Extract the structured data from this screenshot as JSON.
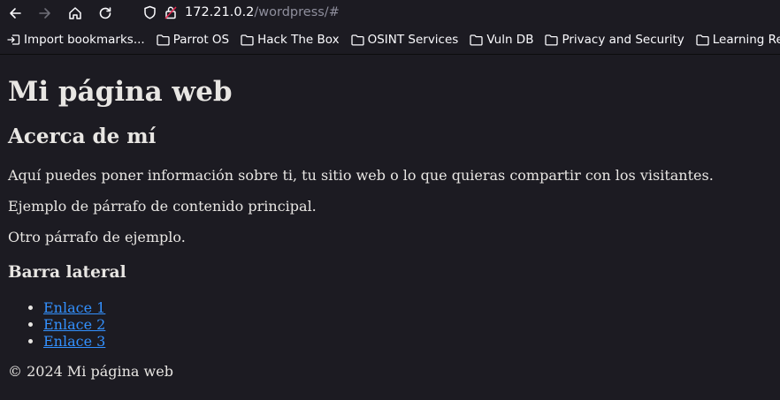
{
  "browser": {
    "url_host": "172.21.0.2",
    "url_path": "/wordpress/#",
    "bookmarks": [
      {
        "label": "Import bookmarks...",
        "icon": "import-icon"
      },
      {
        "label": "Parrot OS",
        "icon": "folder-icon"
      },
      {
        "label": "Hack The Box",
        "icon": "folder-icon"
      },
      {
        "label": "OSINT Services",
        "icon": "folder-icon"
      },
      {
        "label": "Vuln DB",
        "icon": "folder-icon"
      },
      {
        "label": "Privacy and Security",
        "icon": "folder-icon"
      },
      {
        "label": "Learning Re",
        "icon": "folder-icon"
      }
    ]
  },
  "page": {
    "title": "Mi página web",
    "section_heading": "Acerca de mí",
    "paragraphs": [
      "Aquí puedes poner información sobre ti, tu sitio web o lo que quieras compartir con los visitantes.",
      "Ejemplo de párrafo de contenido principal.",
      "Otro párrafo de ejemplo."
    ],
    "sidebar_heading": "Barra lateral",
    "links": [
      "Enlace 1",
      "Enlace 2",
      "Enlace 3"
    ],
    "footer": "© 2024 Mi página web"
  },
  "colors": {
    "background": "#1c1b22",
    "text": "#e8e6e3",
    "link": "#3391ff"
  }
}
